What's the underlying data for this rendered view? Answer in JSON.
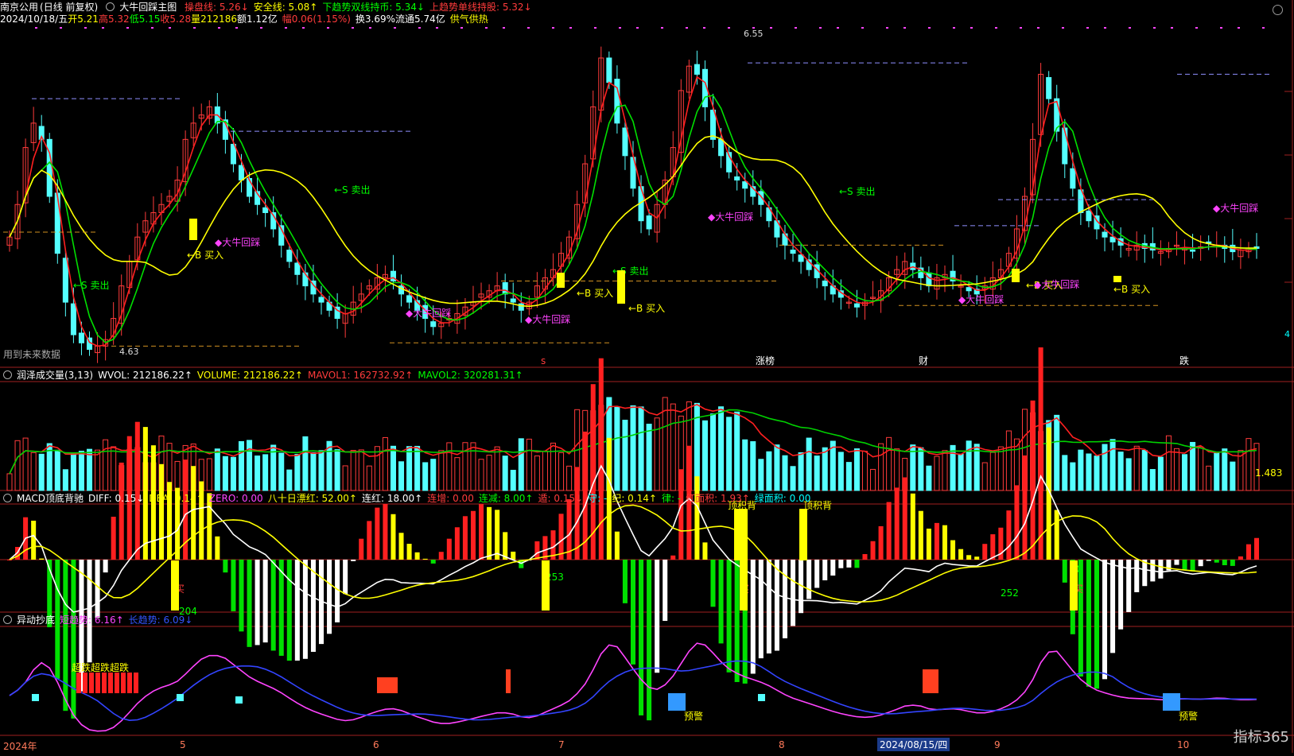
{
  "header": {
    "stock": "南京公用",
    "mode": "(日线 前复权)",
    "indicator": "大牛回踩主图",
    "items": [
      {
        "label": "操盘线: 5.26",
        "color": "#ff3b3b",
        "arrow": "↓"
      },
      {
        "label": "安全线: 5.08",
        "color": "#ffff00",
        "arrow": "↑"
      },
      {
        "label": "下趋势双线持币: 5.34",
        "color": "#00ff00",
        "arrow": "↓"
      },
      {
        "label": "上趋势单线持股: 5.32",
        "color": "#ff3b3b",
        "arrow": "↓"
      }
    ]
  },
  "quote": {
    "date": "2024/10/18/五",
    "open": "开5.21",
    "high": "高5.32",
    "low": "低5.15",
    "close": "收5.28",
    "vol": "量212186",
    "amount": "额1.12亿",
    "change": "幅0.06(1.15%)",
    "turnover": "换3.69%",
    "float": "流通5.74亿",
    "concept": "供气供热"
  },
  "main_labels": {
    "high_price": "6.55",
    "low_price": "4.63",
    "future_note": "用到未来数据",
    "right_edge": "4",
    "sell": "S 卖出",
    "buy": "B 买入",
    "pullback": "大牛回踩",
    "tags": [
      {
        "text": "s",
        "color": "#ff3b3b"
      },
      {
        "text": "涨榜",
        "color": "#ffffff"
      },
      {
        "text": "财",
        "color": "#ffffff"
      },
      {
        "text": "跌",
        "color": "#ffffff"
      }
    ]
  },
  "vol_panel": {
    "title": "润泽成交量(3,13)",
    "items": [
      {
        "label": "WVOL: 212186.22↑",
        "color": "#ffffff"
      },
      {
        "label": "VOLUME: 212186.22↑",
        "color": "#ffff00"
      },
      {
        "label": "MAVOL1: 162732.92↑",
        "color": "#ff3b3b"
      },
      {
        "label": "MAVOL2: 320281.31↑",
        "color": "#00ff00"
      }
    ],
    "right_value": "1.483"
  },
  "macd_panel": {
    "title": "MACD顶底背驰",
    "items": [
      {
        "label": "DIFF: 0.15↓",
        "color": "#ffffff"
      },
      {
        "label": "DEA: 0.14↑",
        "color": "#ffff00"
      },
      {
        "label": "ZERO: 0.00",
        "color": "#ff44ff"
      },
      {
        "label": "八十日漂红: 52.00↑",
        "color": "#ffff00"
      },
      {
        "label": "连红: 18.00↑",
        "color": "#ffffff"
      },
      {
        "label": "连增: 0.00",
        "color": "#ff3b3b"
      },
      {
        "label": "连减: 8.00↑",
        "color": "#00ff00"
      },
      {
        "label": "遁: 0.15↓",
        "color": "#ff3b3b"
      },
      {
        "label": "守: -",
        "color": "#00ffff"
      },
      {
        "label": "纪: 0.14↑",
        "color": "#ffff00"
      },
      {
        "label": "律: -",
        "color": "#00ff00"
      },
      {
        "label": "红面积: 1.93↑",
        "color": "#ff3b3b"
      },
      {
        "label": "绿面积: 0.00",
        "color": "#00ffff"
      }
    ],
    "tags": [
      "顶积背",
      "顶积背",
      "买",
      "买",
      "买",
      "253",
      "252",
      "0",
      "204"
    ]
  },
  "yd_panel": {
    "title": "异动抄底",
    "items": [
      {
        "label": "短趋势: 6.16↑",
        "color": "#ff44ff"
      },
      {
        "label": "长趋势: 6.09↓",
        "color": "#3355ff"
      }
    ],
    "tags": [
      "超跌超跌超跌",
      "预警",
      "预警"
    ]
  },
  "xaxis": {
    "labels": [
      "2024年",
      "5",
      "6",
      "7",
      "8",
      "9",
      "10"
    ],
    "highlight": "2024/08/15/四"
  },
  "brand": "指标365",
  "chart_data": {
    "type": "candlestick",
    "title": "大牛回踩主图",
    "ylim": [
      4.55,
      6.65
    ],
    "x": [
      0,
      1,
      2,
      3,
      4,
      5,
      6,
      7,
      8,
      9,
      10,
      11,
      12,
      13,
      14,
      15,
      16,
      17,
      18,
      19,
      20,
      21,
      22,
      23,
      24,
      25,
      26,
      27,
      28,
      29,
      30,
      31,
      32,
      33,
      34,
      35,
      36,
      37,
      38,
      39,
      40,
      41,
      42,
      43,
      44,
      45,
      46,
      47,
      48,
      49,
      50,
      51,
      52,
      53,
      54,
      55,
      56,
      57,
      58,
      59,
      60,
      61,
      62,
      63,
      64,
      65,
      66,
      67,
      68,
      69,
      70,
      71,
      72,
      73,
      74,
      75,
      76,
      77,
      78,
      79,
      80,
      81,
      82,
      83,
      84,
      85,
      86,
      87,
      88,
      89,
      90,
      91,
      92,
      93,
      94,
      95,
      96,
      97,
      98,
      99,
      100,
      101,
      102,
      103,
      104,
      105,
      106,
      107,
      108,
      109,
      110,
      111,
      112,
      113,
      114,
      115,
      116,
      117,
      118,
      119,
      120,
      121,
      122,
      123,
      124,
      125,
      126,
      127,
      128,
      129,
      130,
      131,
      132,
      133,
      134,
      135,
      136,
      137,
      138,
      139,
      140,
      141,
      142,
      143,
      144,
      145,
      146,
      147,
      148,
      149,
      150,
      151,
      152,
      153,
      154,
      155,
      156
    ],
    "close": [
      5.35,
      5.55,
      5.9,
      6.05,
      5.95,
      5.6,
      5.25,
      4.95,
      4.75,
      4.7,
      4.66,
      4.68,
      4.72,
      4.85,
      5.05,
      5.2,
      5.35,
      5.45,
      5.5,
      5.55,
      5.6,
      5.7,
      5.95,
      6.05,
      6.1,
      6.15,
      6.05,
      5.95,
      5.8,
      5.7,
      5.6,
      5.55,
      5.5,
      5.4,
      5.3,
      5.2,
      5.12,
      5.05,
      5.0,
      4.95,
      4.9,
      4.85,
      4.88,
      4.95,
      5.0,
      5.05,
      5.1,
      5.12,
      5.08,
      5.0,
      4.95,
      4.9,
      4.85,
      4.8,
      4.82,
      4.85,
      4.88,
      4.92,
      4.95,
      5.0,
      5.02,
      5.05,
      5.0,
      4.95,
      4.9,
      4.95,
      5.05,
      5.1,
      5.15,
      5.25,
      5.35,
      5.55,
      5.8,
      6.15,
      6.45,
      6.3,
      6.05,
      5.85,
      5.65,
      5.45,
      5.4,
      5.55,
      5.7,
      5.9,
      6.25,
      6.4,
      6.35,
      6.15,
      5.95,
      5.85,
      5.75,
      5.7,
      5.65,
      5.6,
      5.55,
      5.45,
      5.35,
      5.3,
      5.25,
      5.2,
      5.15,
      5.1,
      5.05,
      5.0,
      4.98,
      4.95,
      4.92,
      4.95,
      4.98,
      5.02,
      5.1,
      5.15,
      5.2,
      5.15,
      5.1,
      5.05,
      5.1,
      5.12,
      5.08,
      5.05,
      5.02,
      5.0,
      5.05,
      5.1,
      5.15,
      5.25,
      5.4,
      5.6,
      5.95,
      6.35,
      6.2,
      6.0,
      5.8,
      5.65,
      5.5,
      5.45,
      5.4,
      5.35,
      5.32,
      5.3,
      5.28,
      5.3,
      5.28,
      5.27,
      5.26,
      5.28,
      5.3,
      5.28,
      5.27,
      5.29,
      5.31,
      5.3,
      5.28,
      5.26,
      5.27,
      5.28,
      5.28
    ]
  }
}
